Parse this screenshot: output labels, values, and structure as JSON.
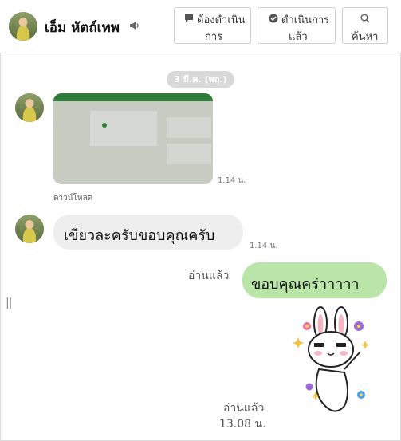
{
  "header": {
    "name": "เอ็ม หัตถ์เทพ",
    "buttons": [
      {
        "icon": "speech-bubble-icon",
        "line1": "ต้องดำเนิน",
        "line2": "การ"
      },
      {
        "icon": "check-circle-icon",
        "line1": "ดำเนินการ",
        "line2": "แล้ว"
      },
      {
        "icon": "search-icon",
        "line1": "",
        "line2": "ค้นหา"
      }
    ]
  },
  "chat": {
    "date": "3 มี.ค. (พฤ.)",
    "messages": [
      {
        "type": "image",
        "time": "1.14 น.",
        "download": "ดาวน์โหลด"
      },
      {
        "type": "text",
        "text": "เขียวละครับขอบคุณครับ",
        "time": "1.14 น."
      },
      {
        "type": "text-out",
        "text": "ขอบคุณคร่าาาาา",
        "read": "อ่านแล้ว"
      },
      {
        "type": "sticker",
        "read": "อ่านแล้ว",
        "time": "13.08 น."
      }
    ],
    "drag_handle": "||"
  },
  "colors": {
    "outgoing_bubble": "#b9e6a8",
    "incoming_bubble": "#eeeeee",
    "date_pill": "#d9d9d9"
  }
}
